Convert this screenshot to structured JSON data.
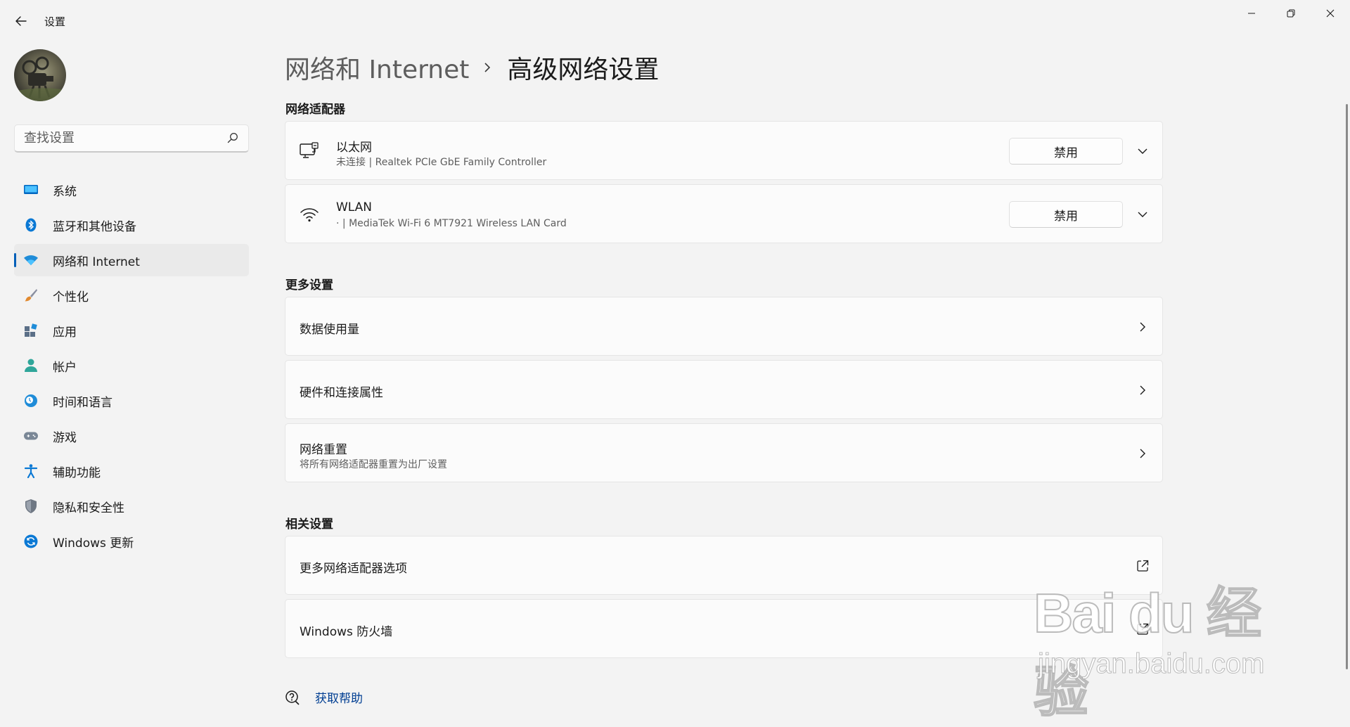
{
  "window": {
    "app_title": "设置",
    "back_icon": "back-arrow-icon",
    "controls": [
      "minimize-icon",
      "restore-icon",
      "close-icon"
    ]
  },
  "sidebar": {
    "search_placeholder": "查找设置",
    "items": [
      {
        "label": "系统",
        "icon": "system-icon",
        "color": "#0067c0"
      },
      {
        "label": "蓝牙和其他设备",
        "icon": "bluetooth-icon",
        "color": "#0a78d4"
      },
      {
        "label": "网络和 Internet",
        "icon": "network-icon",
        "color": "#1f8cd8",
        "selected": true
      },
      {
        "label": "个性化",
        "icon": "brush-icon",
        "color": "#d17a2c"
      },
      {
        "label": "应用",
        "icon": "apps-icon",
        "color": "#5b6f87"
      },
      {
        "label": "帐户",
        "icon": "account-icon",
        "color": "#2fa69a"
      },
      {
        "label": "时间和语言",
        "icon": "clock-globe-icon",
        "color": "#1f8cd8"
      },
      {
        "label": "游戏",
        "icon": "gamepad-icon",
        "color": "#7a8796"
      },
      {
        "label": "辅助功能",
        "icon": "accessibility-icon",
        "color": "#0a78d4"
      },
      {
        "label": "隐私和安全性",
        "icon": "shield-icon",
        "color": "#6f7884"
      },
      {
        "label": "Windows 更新",
        "icon": "update-icon",
        "color": "#0a78d4"
      }
    ]
  },
  "breadcrumb": {
    "parent": "网络和 Internet",
    "current": "高级网络设置"
  },
  "adapters": {
    "section_title": "网络适配器",
    "items": [
      {
        "name": "以太网",
        "status": "未连接 | Realtek PCIe GbE Family Controller",
        "button": "禁用",
        "icon": "ethernet-icon"
      },
      {
        "name": "WLAN",
        "status": "· | MediaTek Wi-Fi 6 MT7921 Wireless LAN Card",
        "button": "禁用",
        "icon": "wifi-icon"
      }
    ]
  },
  "more_settings": {
    "section_title": "更多设置",
    "items": [
      {
        "title": "数据使用量"
      },
      {
        "title": "硬件和连接属性"
      },
      {
        "title": "网络重置",
        "subtitle": "将所有网络适配器重置为出厂设置"
      }
    ]
  },
  "related_settings": {
    "section_title": "相关设置",
    "items": [
      {
        "title": "更多网络适配器选项"
      },
      {
        "title": "Windows 防火墙"
      }
    ]
  },
  "help": {
    "label": "获取帮助"
  },
  "watermark": {
    "logo": "Bai du 经验",
    "domain": "jingyan.baidu.com"
  },
  "colors": {
    "accent": "#005fb8",
    "link": "#003e92",
    "background": "#f3f3f3",
    "card": "#fbfbfb"
  }
}
